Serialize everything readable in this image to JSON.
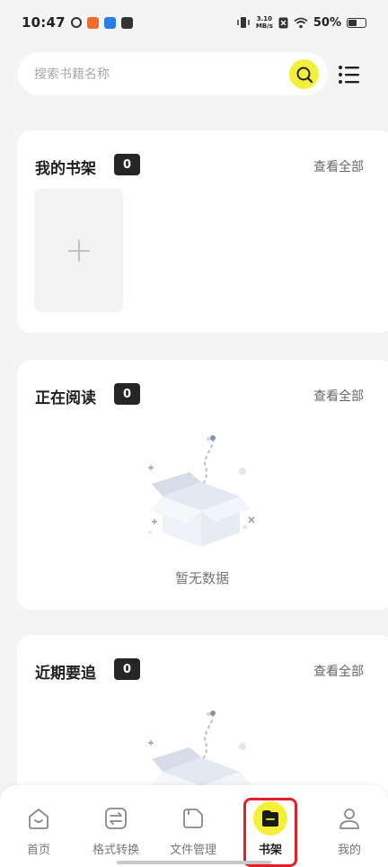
{
  "status": {
    "time": "10:47",
    "net_speed_value": "3.10",
    "net_speed_unit": "MB/s",
    "battery": "50%"
  },
  "search": {
    "placeholder": "搜索书籍名称"
  },
  "sections": [
    {
      "title": "我的书架",
      "count": "0",
      "view_all": "查看全部"
    },
    {
      "title": "正在阅读",
      "count": "0",
      "view_all": "查看全部",
      "empty_text": "暂无数据"
    },
    {
      "title": "近期要追",
      "count": "0",
      "view_all": "查看全部"
    }
  ],
  "nav": [
    {
      "label": "首页",
      "icon": "home-icon"
    },
    {
      "label": "格式转换",
      "icon": "convert-icon"
    },
    {
      "label": "文件管理",
      "icon": "file-icon"
    },
    {
      "label": "书架",
      "icon": "bookshelf-icon",
      "active": true
    },
    {
      "label": "我的",
      "icon": "profile-icon"
    }
  ],
  "colors": {
    "accent": "#f4ef3a",
    "highlight": "#e0202a",
    "badge": "#262626"
  }
}
